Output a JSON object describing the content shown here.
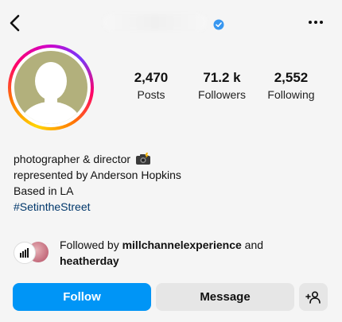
{
  "header": {
    "back_icon": "chevron-left-icon",
    "verified_icon": "verified-badge-icon",
    "more_icon": "more-horizontal-icon"
  },
  "stats": [
    {
      "value": "2,470",
      "label": "Posts"
    },
    {
      "value": "71.2 k",
      "label": "Followers"
    },
    {
      "value": "2,552",
      "label": "Following"
    }
  ],
  "bio": {
    "line1": "photographer & director",
    "line1_emoji": "camera-with-flash-icon",
    "line2": "represented by Anderson Hopkins",
    "line3": "Based in LA",
    "hashtag": "#SetintheStreet"
  },
  "followed_by": {
    "prefix": "Followed by",
    "user1": "millchannelexperience",
    "conjunction": "and",
    "user2": "heatherday"
  },
  "actions": {
    "follow": "Follow",
    "message": "Message",
    "add_user_icon": "add-user-icon"
  },
  "colors": {
    "accent": "#0095f6",
    "hashtag": "#00376b",
    "secondary_button": "#e6e6e6",
    "avatar_placeholder": "#b2b07c"
  }
}
